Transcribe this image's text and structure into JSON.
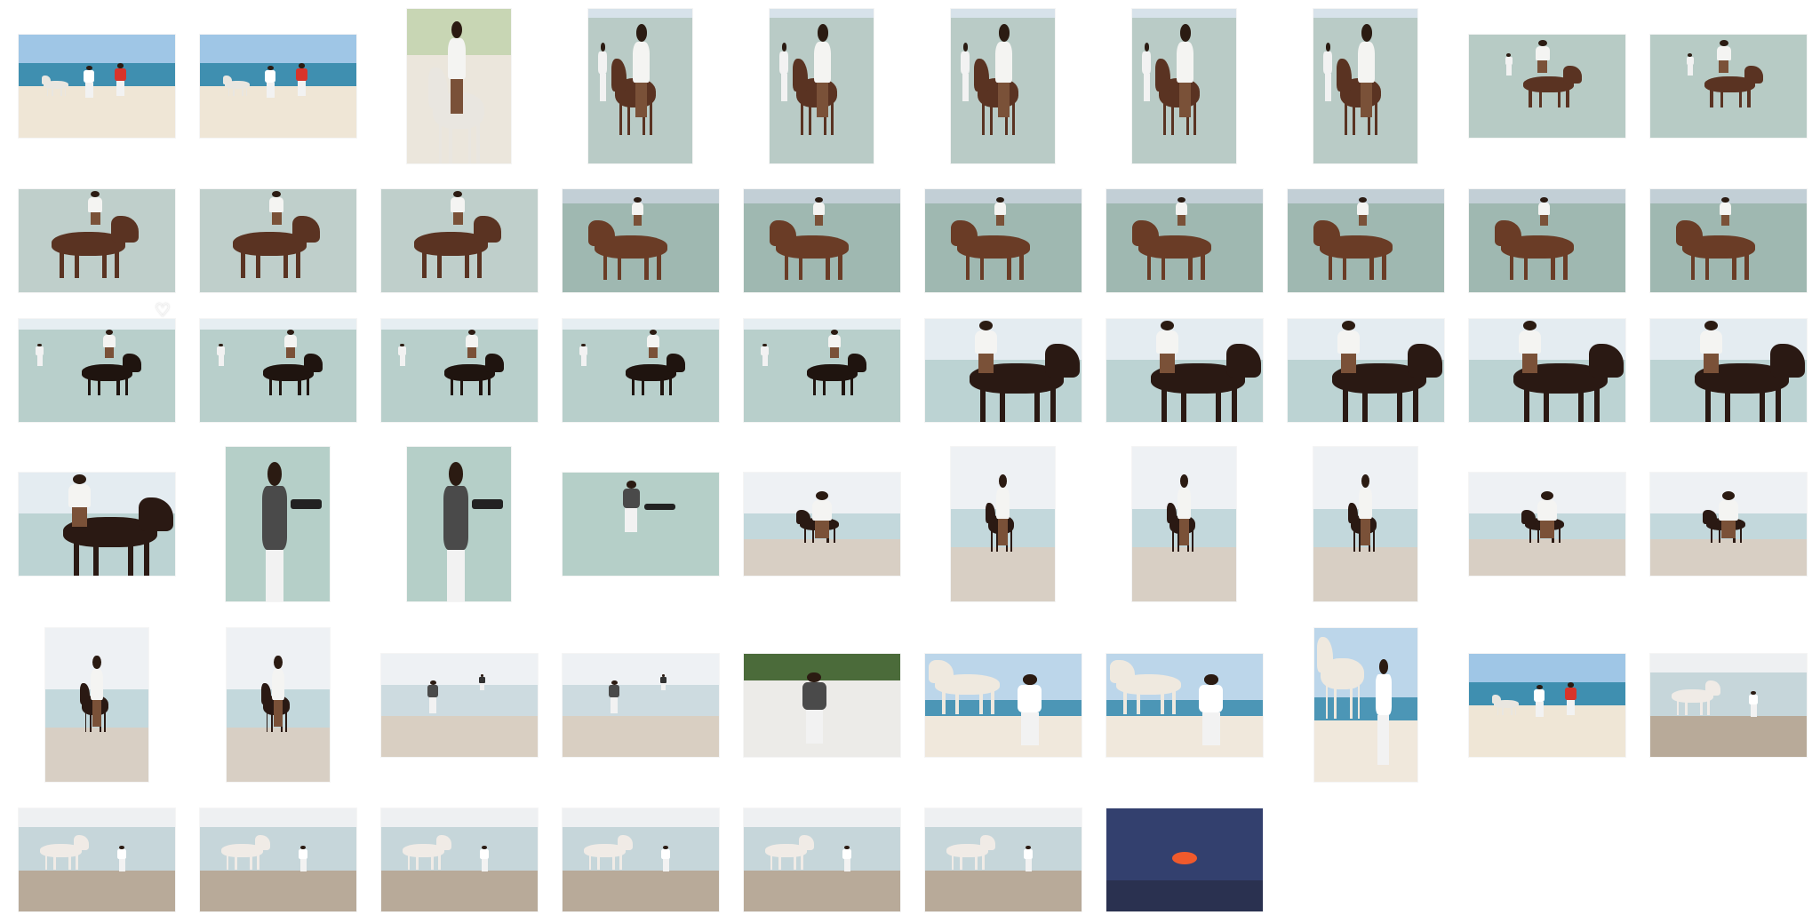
{
  "gallery": {
    "thumbnail_count": 57,
    "colors": {
      "background": "#ffffff",
      "sky": "#dbe7ef",
      "sea": "#a9c4c2",
      "sand": "#e8e2d6",
      "brown_horse": "#5a3322",
      "white_horse": "#e9e6e0",
      "sunset_sky": "#33406e"
    }
  },
  "icons": {
    "favorite": "heart-icon"
  }
}
